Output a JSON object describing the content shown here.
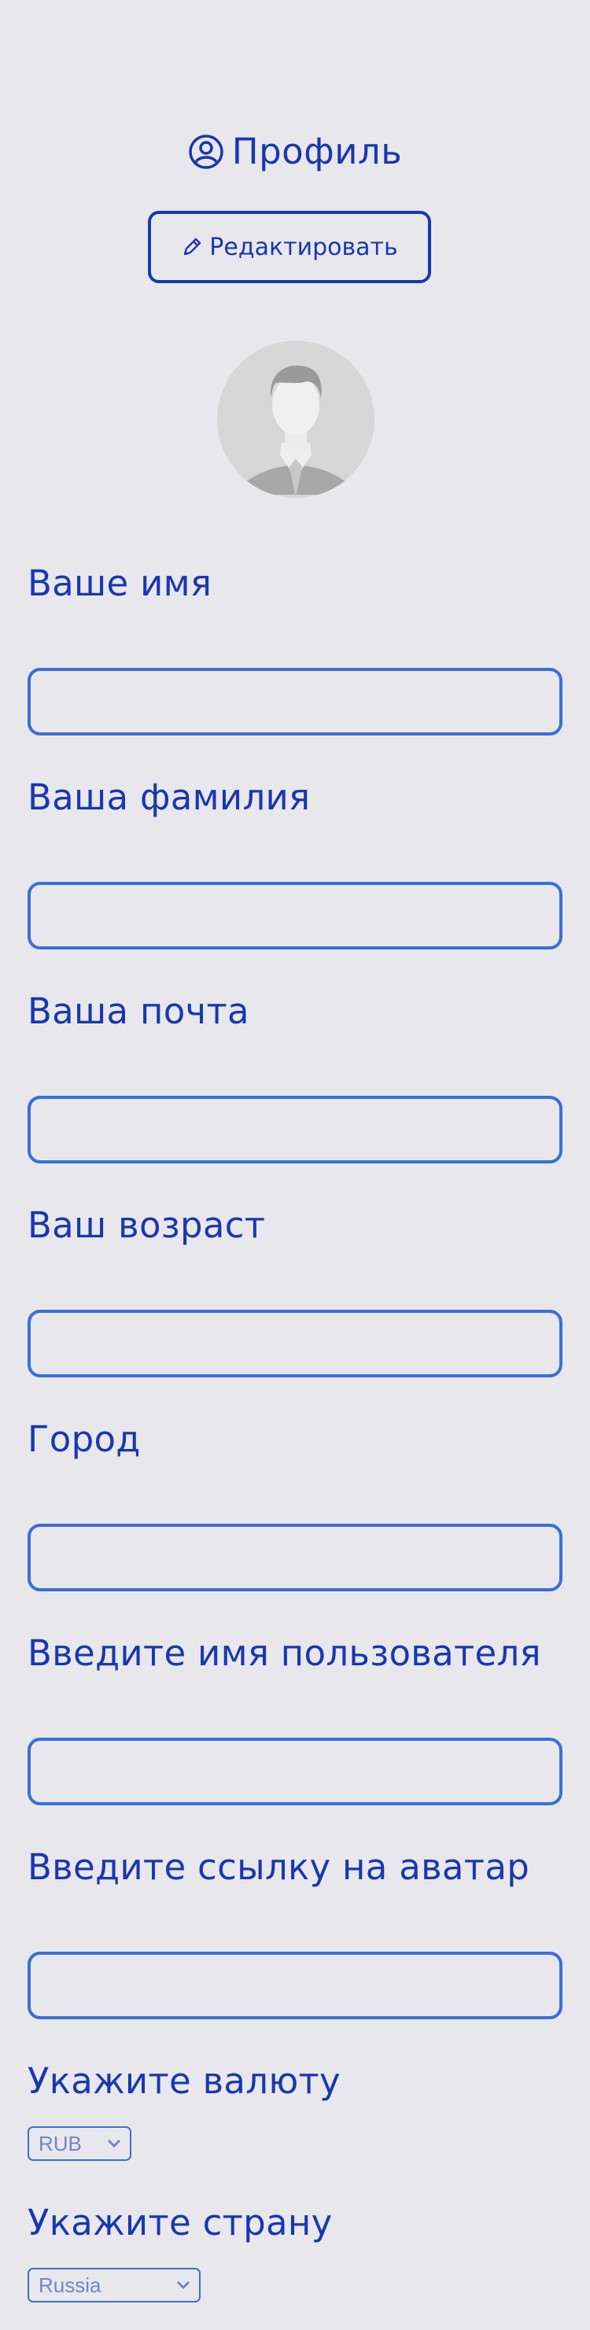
{
  "header": {
    "title": "Профиль",
    "icon": "user-circle-icon"
  },
  "edit_button": {
    "label": "Редактировать",
    "icon": "pencil-icon"
  },
  "avatar": {
    "icon": "default-user-avatar"
  },
  "fields": [
    {
      "label": "Ваше имя",
      "value": ""
    },
    {
      "label": "Ваша фамилия",
      "value": ""
    },
    {
      "label": "Ваша почта",
      "value": ""
    },
    {
      "label": "Ваш возраст",
      "value": ""
    },
    {
      "label": "Город",
      "value": ""
    },
    {
      "label": "Введите имя пользователя",
      "value": ""
    },
    {
      "label": "Введите ссылку на аватар",
      "value": ""
    }
  ],
  "currency": {
    "label": "Укажите валюту",
    "selected": "RUB"
  },
  "country": {
    "label": "Укажите страну",
    "selected": "Russia"
  },
  "colors": {
    "background": "#e8e8ec",
    "primary": "#1a37b0",
    "input_border": "#3a6fd8"
  }
}
